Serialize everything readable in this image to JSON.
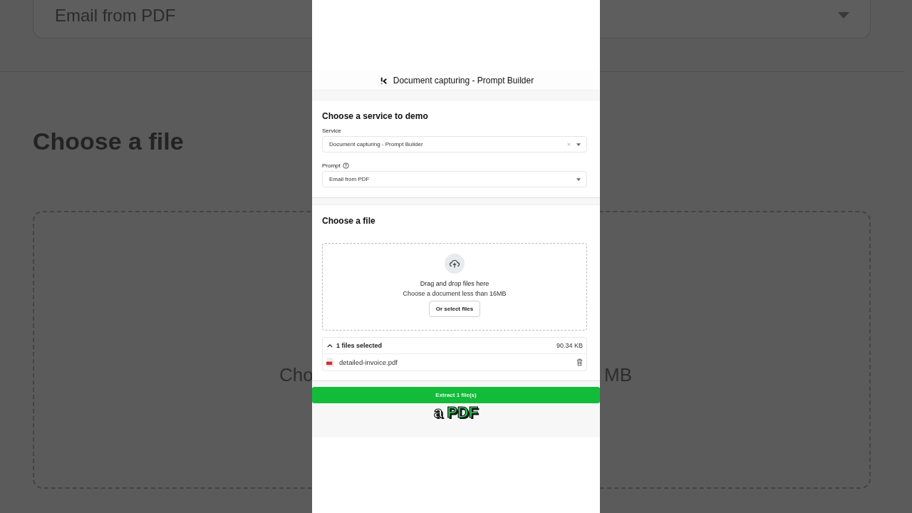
{
  "background": {
    "prompt_value": "Email from PDF",
    "heading": "Choose a file",
    "text_left": "Cho",
    "text_right": "MB"
  },
  "header": {
    "title": "Document capturing - Prompt Builder"
  },
  "service_card": {
    "title": "Choose a service to demo",
    "fields": [
      {
        "kind": "clearable",
        "label": "Service",
        "value": "Document capturing - Prompt Builder",
        "help": false
      },
      {
        "kind": "select",
        "label": "Prompt",
        "value": "Email from PDF",
        "help": true
      }
    ]
  },
  "file_card": {
    "title": "Choose a file",
    "drop_title": "Drag and drop files here",
    "drop_hint": "Choose a document less than 16MB",
    "select_button": "Or select files",
    "selected": {
      "summary": "1 files selected",
      "size": "90.34 KB",
      "expanded": true,
      "files": [
        {
          "name": "detailed-invoice.pdf"
        }
      ]
    }
  },
  "extract_button": "Extract 1 file(s)",
  "caption": [
    {
      "text": "a",
      "color": "#ffffff"
    },
    {
      "text": "PDF",
      "color": "#2ed158"
    }
  ]
}
